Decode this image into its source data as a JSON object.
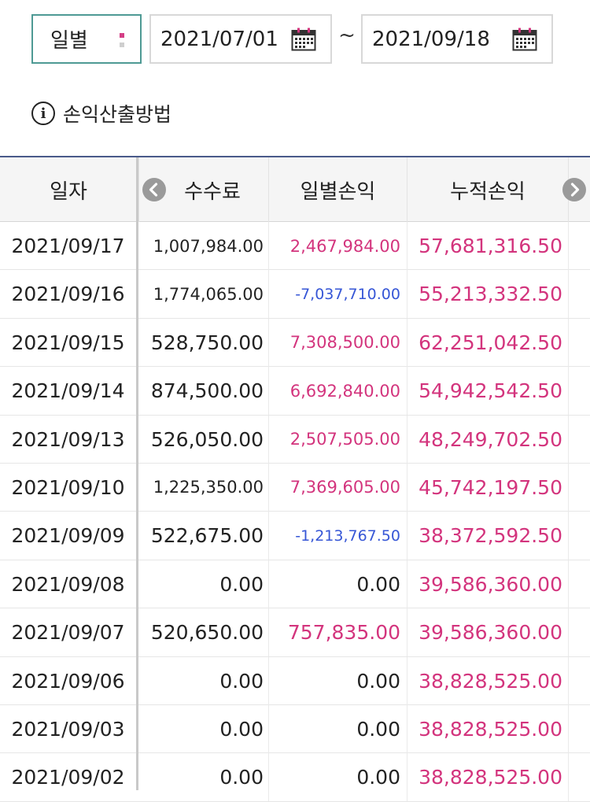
{
  "filter": {
    "period": "일별",
    "start_date": "2021/07/01",
    "separator": "~",
    "end_date": "2021/09/18",
    "calendar_icon": "calendar-icon"
  },
  "info": {
    "icon": "info-icon",
    "icon_glyph": "i",
    "label": "손익산출방법"
  },
  "table": {
    "columns": [
      "일자",
      "수수료",
      "일별손익",
      "누적손익"
    ],
    "rows": [
      {
        "date": "2021/09/17",
        "fee": "1,007,984.00",
        "daily": "2,467,984.00",
        "cumulative": "57,681,316.50",
        "daily_sign": "pos"
      },
      {
        "date": "2021/09/16",
        "fee": "1,774,065.00",
        "daily": "-7,037,710.00",
        "cumulative": "55,213,332.50",
        "daily_sign": "neg"
      },
      {
        "date": "2021/09/15",
        "fee": "528,750.00",
        "daily": "7,308,500.00",
        "cumulative": "62,251,042.50",
        "daily_sign": "pos"
      },
      {
        "date": "2021/09/14",
        "fee": "874,500.00",
        "daily": "6,692,840.00",
        "cumulative": "54,942,542.50",
        "daily_sign": "pos"
      },
      {
        "date": "2021/09/13",
        "fee": "526,050.00",
        "daily": "2,507,505.00",
        "cumulative": "48,249,702.50",
        "daily_sign": "pos"
      },
      {
        "date": "2021/09/10",
        "fee": "1,225,350.00",
        "daily": "7,369,605.00",
        "cumulative": "45,742,197.50",
        "daily_sign": "pos"
      },
      {
        "date": "2021/09/09",
        "fee": "522,675.00",
        "daily": "-1,213,767.50",
        "cumulative": "38,372,592.50",
        "daily_sign": "neg"
      },
      {
        "date": "2021/09/08",
        "fee": "0.00",
        "daily": "0.00",
        "cumulative": "39,586,360.00",
        "daily_sign": "zero"
      },
      {
        "date": "2021/09/07",
        "fee": "520,650.00",
        "daily": "757,835.00",
        "cumulative": "39,586,360.00",
        "daily_sign": "pos"
      },
      {
        "date": "2021/09/06",
        "fee": "0.00",
        "daily": "0.00",
        "cumulative": "38,828,525.00",
        "daily_sign": "zero"
      },
      {
        "date": "2021/09/03",
        "fee": "0.00",
        "daily": "0.00",
        "cumulative": "38,828,525.00",
        "daily_sign": "zero"
      },
      {
        "date": "2021/09/02",
        "fee": "0.00",
        "daily": "0.00",
        "cumulative": "38,828,525.00",
        "daily_sign": "zero"
      }
    ]
  },
  "colors": {
    "positive": "#d3347d",
    "negative": "#3656d6",
    "select_border": "#4e9a94",
    "header_rule": "#4a5a8a"
  }
}
